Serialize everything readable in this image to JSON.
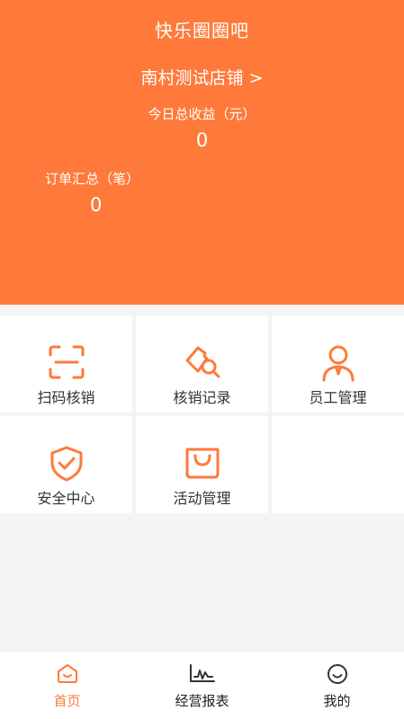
{
  "header": {
    "app_title": "快乐圈圈吧",
    "store_name": "南村测试店铺",
    "store_chevron": ">",
    "income_label": "今日总收益（元）",
    "income_value": "0",
    "orders_label": "订单汇总（笔）",
    "orders_value": "0"
  },
  "tiles": [
    {
      "label": "扫码核销",
      "icon": "scan-icon"
    },
    {
      "label": "核销记录",
      "icon": "ticket-search-icon"
    },
    {
      "label": "员工管理",
      "icon": "staff-icon"
    },
    {
      "label": "安全中心",
      "icon": "shield-check-icon"
    },
    {
      "label": "活动管理",
      "icon": "shopping-bag-icon"
    }
  ],
  "nav": [
    {
      "label": "首页",
      "icon": "home-icon",
      "active": true
    },
    {
      "label": "经营报表",
      "icon": "chart-icon",
      "active": false
    },
    {
      "label": "我的",
      "icon": "smile-icon",
      "active": false
    }
  ],
  "colors": {
    "accent": "#ff7a3a",
    "background": "#f4f4f4",
    "tile": "#ffffff"
  }
}
